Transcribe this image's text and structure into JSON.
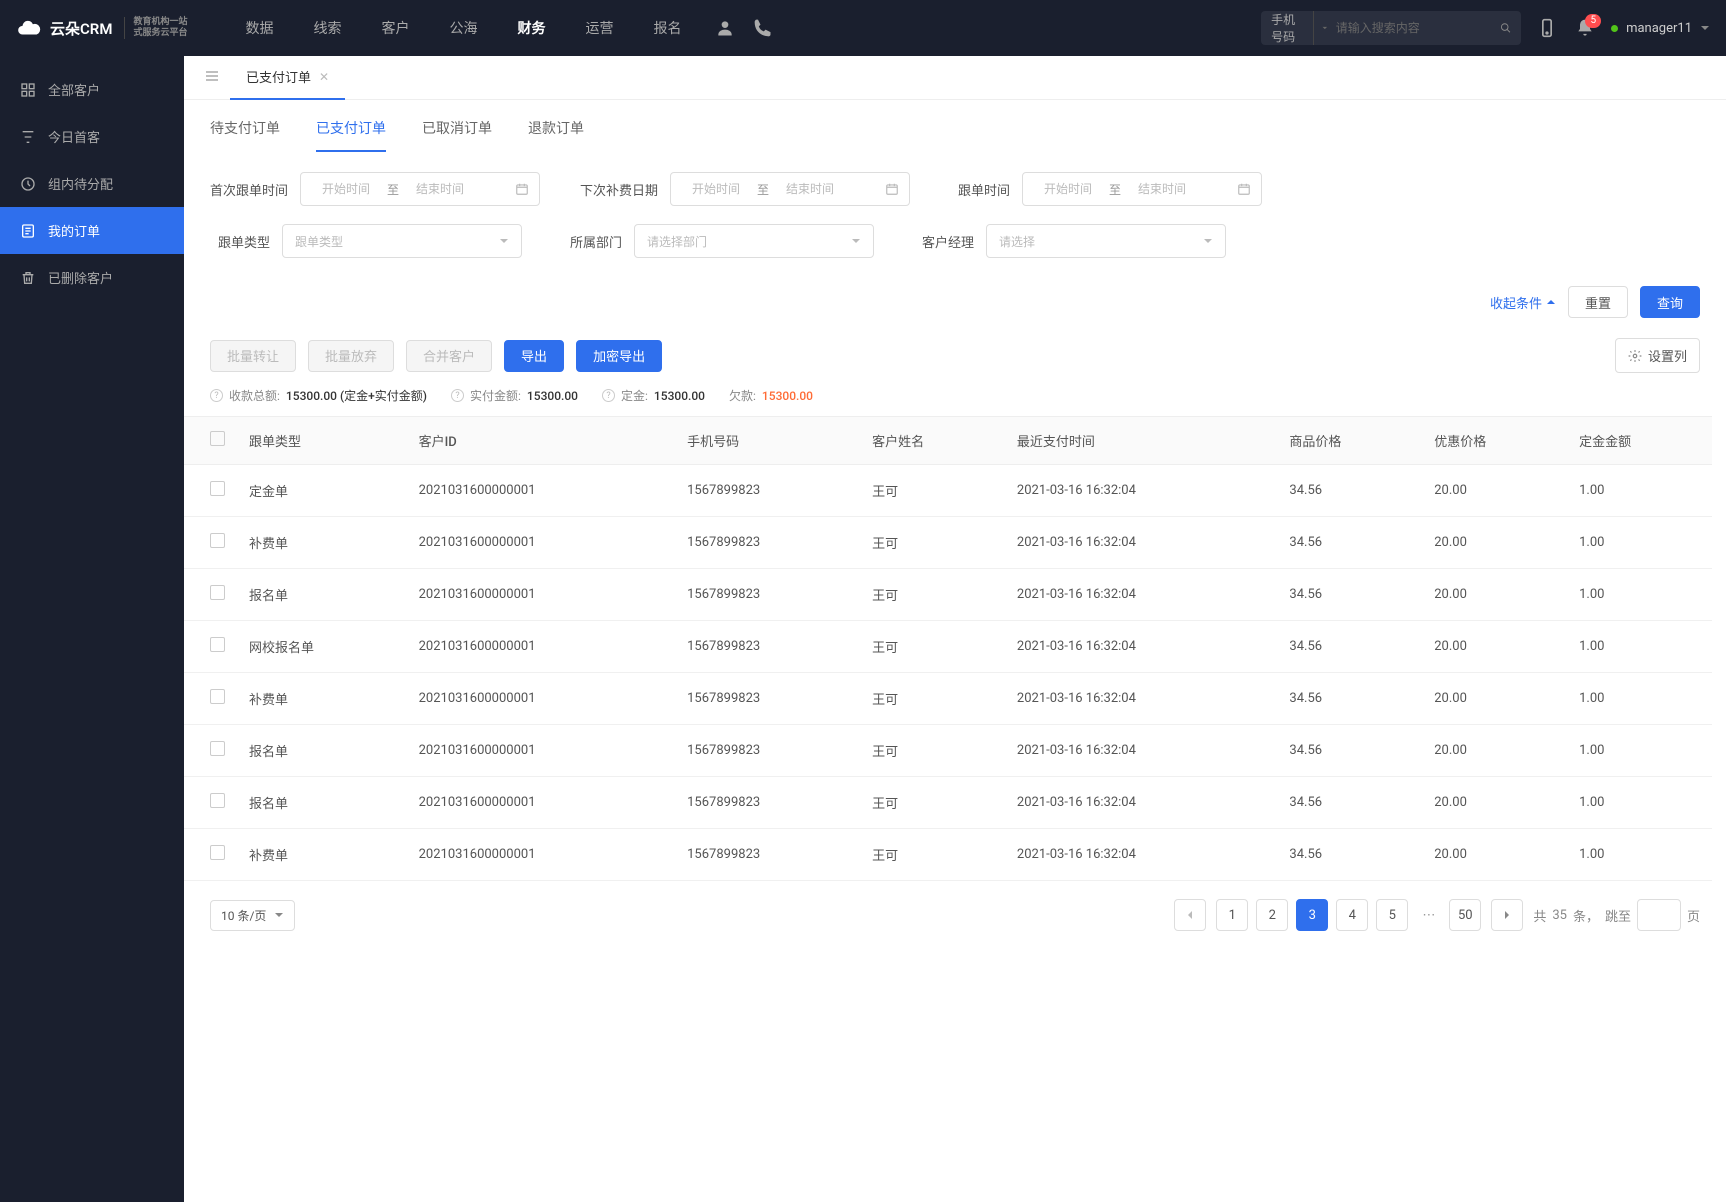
{
  "brand": {
    "name": "云朵CRM",
    "sub1": "教育机构一站",
    "sub2": "式服务云平台"
  },
  "topNav": [
    "数据",
    "线索",
    "客户",
    "公海",
    "财务",
    "运营",
    "报名"
  ],
  "topNavActive": 4,
  "search": {
    "label": "手机号码",
    "placeholder": "请输入搜索内容"
  },
  "notifBadge": "5",
  "user": {
    "name": "manager11"
  },
  "sidebar": [
    {
      "label": "全部客户"
    },
    {
      "label": "今日首客"
    },
    {
      "label": "组内待分配"
    },
    {
      "label": "我的订单"
    },
    {
      "label": "已删除客户"
    }
  ],
  "sidebarActive": 3,
  "pageTab": {
    "label": "已支付订单"
  },
  "subTabs": [
    "待支付订单",
    "已支付订单",
    "已取消订单",
    "退款订单"
  ],
  "subTabActive": 1,
  "filters": {
    "firstFollowLabel": "首次跟单时间",
    "nextPayLabel": "下次补费日期",
    "followTimeLabel": "跟单时间",
    "typeLabel": "跟单类型",
    "deptLabel": "所属部门",
    "managerLabel": "客户经理",
    "startPh": "开始时间",
    "endPh": "结束时间",
    "toText": "至",
    "typePh": "跟单类型",
    "deptPh": "请选择部门",
    "managerPh": "请选择",
    "collapse": "收起条件",
    "reset": "重置",
    "query": "查询"
  },
  "toolbar": {
    "transfer": "批量转让",
    "abandon": "批量放弃",
    "merge": "合并客户",
    "export": "导出",
    "encExport": "加密导出",
    "config": "设置列"
  },
  "summary": {
    "totalLabel": "收款总额:",
    "totalVal": "15300.00 (定金+实付金额)",
    "paidLabel": "实付金额:",
    "paidVal": "15300.00",
    "depositLabel": "定金:",
    "depositVal": "15300.00",
    "debtLabel": "欠款:",
    "debtVal": "15300.00"
  },
  "columns": [
    "跟单类型",
    "客户ID",
    "手机号码",
    "客户姓名",
    "最近支付时间",
    "商品价格",
    "优惠价格",
    "定金金额"
  ],
  "rows": [
    {
      "type": "定金单",
      "id": "2021031600000001",
      "phone": "1567899823",
      "name": "王可",
      "time": "2021-03-16 16:32:04",
      "price": "34.56",
      "discount": "20.00",
      "deposit": "1.00"
    },
    {
      "type": "补费单",
      "id": "2021031600000001",
      "phone": "1567899823",
      "name": "王可",
      "time": "2021-03-16 16:32:04",
      "price": "34.56",
      "discount": "20.00",
      "deposit": "1.00"
    },
    {
      "type": "报名单",
      "id": "2021031600000001",
      "phone": "1567899823",
      "name": "王可",
      "time": "2021-03-16 16:32:04",
      "price": "34.56",
      "discount": "20.00",
      "deposit": "1.00"
    },
    {
      "type": "网校报名单",
      "id": "2021031600000001",
      "phone": "1567899823",
      "name": "王可",
      "time": "2021-03-16 16:32:04",
      "price": "34.56",
      "discount": "20.00",
      "deposit": "1.00"
    },
    {
      "type": "补费单",
      "id": "2021031600000001",
      "phone": "1567899823",
      "name": "王可",
      "time": "2021-03-16 16:32:04",
      "price": "34.56",
      "discount": "20.00",
      "deposit": "1.00"
    },
    {
      "type": "报名单",
      "id": "2021031600000001",
      "phone": "1567899823",
      "name": "王可",
      "time": "2021-03-16 16:32:04",
      "price": "34.56",
      "discount": "20.00",
      "deposit": "1.00"
    },
    {
      "type": "报名单",
      "id": "2021031600000001",
      "phone": "1567899823",
      "name": "王可",
      "time": "2021-03-16 16:32:04",
      "price": "34.56",
      "discount": "20.00",
      "deposit": "1.00"
    },
    {
      "type": "补费单",
      "id": "2021031600000001",
      "phone": "1567899823",
      "name": "王可",
      "time": "2021-03-16 16:32:04",
      "price": "34.56",
      "discount": "20.00",
      "deposit": "1.00"
    }
  ],
  "pagination": {
    "pageSize": "10 条/页",
    "pages": [
      "1",
      "2",
      "3",
      "4",
      "5"
    ],
    "active": 2,
    "last": "50",
    "totalPre": "共",
    "totalCount": "35",
    "totalSuf": "条，",
    "jump": "跳至",
    "pageSuf": "页"
  }
}
